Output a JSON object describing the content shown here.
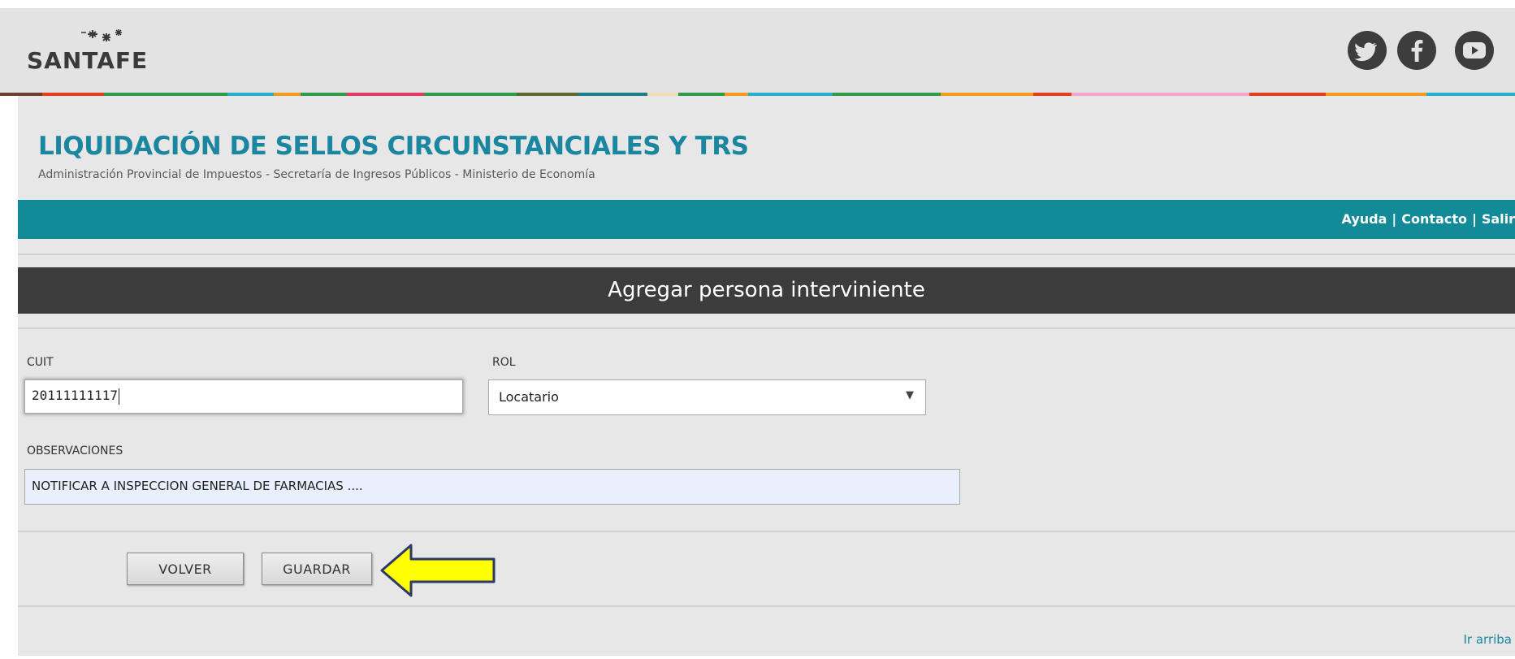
{
  "header": {
    "logo_text": "SANTAFE",
    "social": [
      {
        "name": "twitter",
        "icon": "twitter-icon"
      },
      {
        "name": "facebook",
        "icon": "facebook-icon"
      },
      {
        "name": "youtube",
        "icon": "youtube-icon"
      }
    ]
  },
  "app": {
    "title": "LIQUIDACIÓN DE SELLOS CIRCUNSTANCIALES Y TRS",
    "subtitle": "Administración Provincial de Impuestos - Secretaría de Ingresos Públicos - Ministerio de Economía"
  },
  "nav": {
    "help": "Ayuda",
    "contact": "Contacto",
    "logout": "Salir",
    "separator": "|"
  },
  "section": {
    "title": "Agregar persona interviniente"
  },
  "form": {
    "cuit_label": "CUIT",
    "cuit_value": "20111111117",
    "rol_label": "ROL",
    "rol_value": "Locatario",
    "obs_label": "OBSERVACIONES",
    "obs_value": "NOTIFICAR A INSPECCION GENERAL DE FARMACIAS ...."
  },
  "actions": {
    "back_label": "VOLVER",
    "save_label": "GUARDAR"
  },
  "footer": {
    "go_top": "Ir arriba"
  },
  "colors": {
    "accent_teal": "#138a98",
    "title_blue": "#1a86a0",
    "header_bar": "#3c3c3c",
    "pointer_yellow": "#ffff00",
    "pointer_border": "#2b3a67"
  }
}
